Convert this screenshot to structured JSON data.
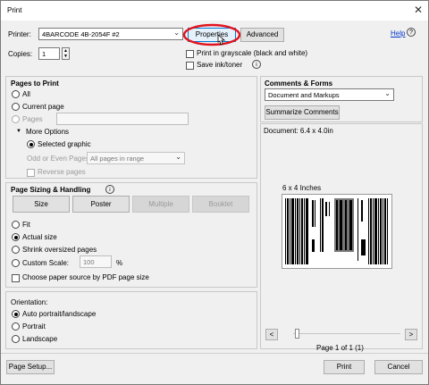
{
  "window": {
    "title": "Print"
  },
  "printer": {
    "label": "Printer:",
    "value": "4BARCODE 4B-2054F #2",
    "properties_label": "Properties",
    "advanced_label": "Advanced",
    "help_label": "Help",
    "copies_label": "Copies:",
    "copies_value": "1",
    "grayscale_label": "Print in grayscale (black and white)",
    "save_ink_label": "Save ink/toner"
  },
  "pages_to_print": {
    "heading": "Pages to Print",
    "all_label": "All",
    "current_label": "Current page",
    "pages_label": "Pages",
    "more_options_label": "More Options",
    "selected_graphic_label": "Selected graphic",
    "odd_even_label": "Odd or Even Pages:",
    "odd_even_value": "All pages in range",
    "reverse_label": "Reverse pages"
  },
  "sizing": {
    "heading": "Page Sizing & Handling",
    "size_label": "Size",
    "poster_label": "Poster",
    "multiple_label": "Multiple",
    "booklet_label": "Booklet",
    "fit_label": "Fit",
    "actual_label": "Actual size",
    "shrink_label": "Shrink oversized pages",
    "custom_label": "Custom Scale:",
    "custom_value": "100",
    "percent": "%",
    "paper_source_label": "Choose paper source by PDF page size"
  },
  "orientation": {
    "heading": "Orientation:",
    "auto_label": "Auto portrait/landscape",
    "portrait_label": "Portrait",
    "landscape_label": "Landscape"
  },
  "comments": {
    "heading": "Comments & Forms",
    "value": "Document and Markups",
    "summarize_label": "Summarize Comments"
  },
  "preview": {
    "document_size": "Document: 6.4 x 4.0in",
    "page_size": "6 x 4 Inches",
    "prev_label": "<",
    "next_label": ">",
    "page_indicator": "Page 1 of 1 (1)"
  },
  "footer": {
    "page_setup_label": "Page Setup...",
    "print_label": "Print",
    "cancel_label": "Cancel"
  },
  "colors": {
    "highlight_ring": "#e0141e",
    "link": "#0033cc"
  }
}
